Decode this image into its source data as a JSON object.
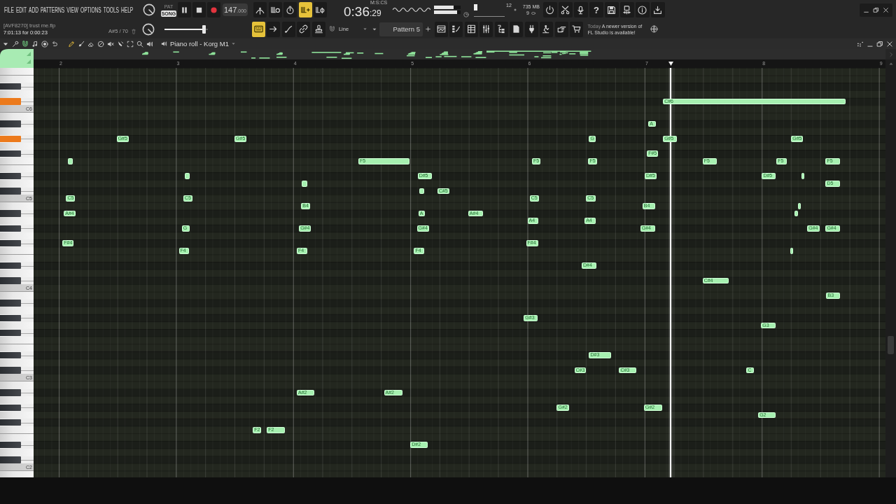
{
  "menu": [
    "FILE",
    "EDIT",
    "ADD",
    "PATTERNS",
    "VIEW",
    "OPTIONS",
    "TOOLS",
    "HELP"
  ],
  "transport": {
    "mode": [
      {
        "label": "PAT",
        "selected": false
      },
      {
        "label": "SONG",
        "selected": true
      }
    ],
    "buttons": [
      {
        "kind": "pause"
      },
      {
        "kind": "stop"
      },
      {
        "kind": "record"
      }
    ],
    "tempo": "147",
    "tempo_fraction": ".000"
  },
  "record_options": [
    {
      "kind": "antenna",
      "on": false
    },
    {
      "kind": "comb-clock",
      "on": false
    },
    {
      "kind": "stopwatch",
      "on": false
    },
    {
      "kind": "comb-plus",
      "on": true
    },
    {
      "kind": "comb-ring",
      "on": false
    }
  ],
  "song_time": {
    "unit": "M:S:CS",
    "main": "0:36",
    "centiseconds": ":29"
  },
  "monitor": {
    "meters": [
      {
        "level": 0.73
      },
      {
        "level": 0.87
      }
    ],
    "pitch_slider": {
      "level": 0
    },
    "polyphony": "12",
    "memory": "735 MB",
    "count": "9"
  },
  "shortcuts": [
    {
      "kind": "power"
    },
    {
      "kind": "scissors"
    },
    {
      "kind": "microphone"
    },
    {
      "kind": "help",
      "label": "?"
    },
    {
      "kind": "save"
    },
    {
      "kind": "save-split"
    },
    {
      "kind": "info"
    },
    {
      "kind": "download"
    }
  ],
  "window_controls": [
    {
      "kind": "minimize"
    },
    {
      "kind": "restore"
    },
    {
      "kind": "close"
    }
  ],
  "project": {
    "name": "[AVF8270] trust me.flp",
    "time": "7:01:13 for 0:00:23"
  },
  "hint": "A#5 / 70",
  "master_volume": {
    "level": 0.95
  },
  "tools": [
    {
      "kind": "typing-keyboard",
      "on": true
    },
    {
      "kind": "arrow-right",
      "on": false
    },
    {
      "kind": "curve",
      "on": false
    },
    {
      "kind": "link",
      "on": false
    },
    {
      "kind": "stamp",
      "on": false
    }
  ],
  "snap": {
    "value": "Line"
  },
  "pattern": {
    "name": "Pattern 5"
  },
  "windows": [
    {
      "kind": "playlist"
    },
    {
      "kind": "step-sequencer"
    },
    {
      "kind": "grid"
    },
    {
      "kind": "mixer"
    },
    {
      "kind": "folder-tree"
    },
    {
      "kind": "document"
    },
    {
      "kind": "plug"
    },
    {
      "kind": "figure"
    },
    {
      "kind": "pointing-hand"
    },
    {
      "kind": "cart"
    }
  ],
  "notice": {
    "label": "Today",
    "text": "A newer version of FL Studio is available!"
  },
  "piano_roll": {
    "title": "Piano roll - Korg M1",
    "options": [
      {
        "kind": "caret",
        "on": false
      },
      {
        "kind": "wrench",
        "on": false
      },
      {
        "kind": "magnet",
        "on": true
      },
      {
        "kind": "music-note",
        "on": false
      },
      {
        "kind": "record-ring",
        "on": false
      },
      {
        "kind": "undo",
        "on": false
      }
    ],
    "tools": [
      {
        "kind": "pencil",
        "selected": true
      },
      {
        "kind": "brush",
        "selected": false
      },
      {
        "kind": "eraser",
        "selected": false
      },
      {
        "kind": "no-entry",
        "selected": false
      },
      {
        "kind": "speaker-mute",
        "selected": false
      },
      {
        "kind": "knife",
        "selected": false
      },
      {
        "kind": "select",
        "selected": false
      },
      {
        "kind": "zoom",
        "selected": false
      },
      {
        "kind": "speaker",
        "selected": false
      }
    ],
    "window_controls": [
      {
        "kind": "dots"
      },
      {
        "kind": "minimize"
      },
      {
        "kind": "restore"
      },
      {
        "kind": "close"
      }
    ],
    "ruler": [
      "2",
      "3",
      "4",
      "5",
      "6",
      "7",
      "8",
      "9"
    ],
    "keyboard": {
      "c_labels": [
        "C6",
        "C5",
        "C4",
        "C3",
        "C2"
      ]
    },
    "notes": [
      {
        "label": "C#6",
        "playing": true
      },
      {
        "label": "A",
        "playing": false
      },
      {
        "label": "G#5",
        "playing": false
      },
      {
        "label": "G#5",
        "playing": false
      },
      {
        "label": "G",
        "playing": false
      },
      {
        "label": "G#5",
        "playing": true
      },
      {
        "label": "G#5",
        "playing": false
      },
      {
        "label": "F#5",
        "playing": false
      },
      {
        "playing": false
      },
      {
        "label": "F5",
        "playing": false
      },
      {
        "label": "F5",
        "playing": false
      },
      {
        "label": "F5",
        "playing": false
      },
      {
        "label": "F5",
        "playing": false
      },
      {
        "label": "F5",
        "playing": false
      },
      {
        "label": "F5",
        "playing": false
      },
      {
        "playing": false
      },
      {
        "label": "D#5",
        "playing": false
      },
      {
        "label": "D#5",
        "playing": false
      },
      {
        "label": "D#5",
        "playing": false
      },
      {
        "playing": false
      },
      {
        "playing": false
      },
      {
        "label": "D5",
        "playing": false
      },
      {
        "playing": false
      },
      {
        "label": "C#5",
        "playing": false
      },
      {
        "label": "C5",
        "playing": false
      },
      {
        "label": "C5",
        "playing": false
      },
      {
        "label": "C5",
        "playing": false
      },
      {
        "label": "C5",
        "playing": false
      },
      {
        "label": "B4",
        "playing": false
      },
      {
        "label": "B4",
        "playing": false
      },
      {
        "playing": false
      },
      {
        "label": "A#4",
        "playing": false
      },
      {
        "label": "A",
        "playing": false
      },
      {
        "label": "A#4",
        "playing": false
      },
      {
        "playing": false
      },
      {
        "label": "A4",
        "playing": false
      },
      {
        "label": "A4",
        "playing": false
      },
      {
        "label": "G",
        "playing": false
      },
      {
        "label": "G#4",
        "playing": false
      },
      {
        "label": "G#4",
        "playing": false
      },
      {
        "label": "G#4",
        "playing": false
      },
      {
        "label": "G#4",
        "playing": false
      },
      {
        "label": "G#4",
        "playing": false
      },
      {
        "label": "F#4",
        "playing": false
      },
      {
        "label": "F#4",
        "playing": false
      },
      {
        "label": "F4",
        "playing": false
      },
      {
        "label": "F4",
        "playing": false
      },
      {
        "label": "F4",
        "playing": false
      },
      {
        "playing": false
      },
      {
        "label": "D#4",
        "playing": false
      },
      {
        "label": "C#4",
        "playing": false
      },
      {
        "label": "B3",
        "playing": false
      },
      {
        "label": "G#3",
        "playing": false
      },
      {
        "label": "G3",
        "playing": false
      },
      {
        "label": "D#3",
        "playing": false
      },
      {
        "label": "C#3",
        "playing": false
      },
      {
        "label": "C#3",
        "playing": false
      },
      {
        "label": "C",
        "playing": false
      },
      {
        "label": "A#2",
        "playing": false
      },
      {
        "label": "A#2",
        "playing": false
      },
      {
        "label": "G#2",
        "playing": false
      },
      {
        "label": "G#2",
        "playing": false
      },
      {
        "label": "G2",
        "playing": false
      },
      {
        "label": "F2",
        "playing": false
      },
      {
        "label": "F2",
        "playing": false
      },
      {
        "label": "D#2",
        "playing": false
      }
    ]
  }
}
